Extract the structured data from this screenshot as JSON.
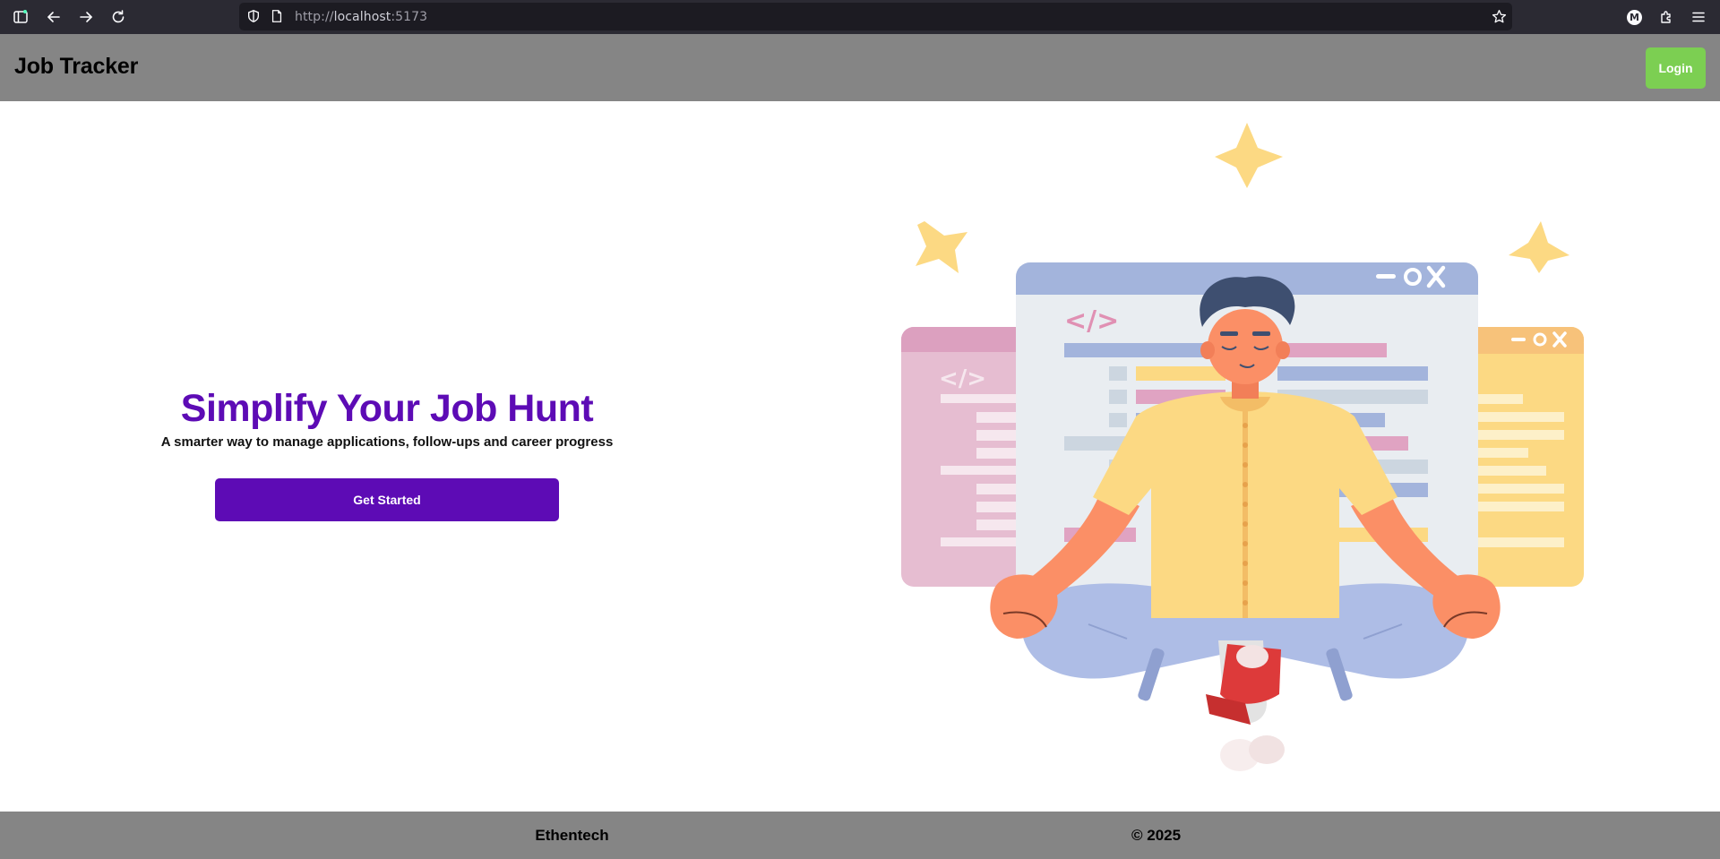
{
  "browser": {
    "url_scheme": "http://",
    "url_host": "localhost",
    "url_port": ":5173",
    "profile_initial": "M"
  },
  "header": {
    "title": "Job Tracker",
    "login_label": "Login"
  },
  "hero": {
    "title": "Simplify Your Job Hunt",
    "subtitle": "A smarter way to manage applications, follow-ups and career progress",
    "cta_label": "Get Started",
    "illustration": {
      "code_tag": "</>",
      "icons": [
        "star-icon",
        "window-minimize-icon",
        "window-maximize-icon",
        "window-close-icon"
      ]
    }
  },
  "footer": {
    "company": "Ethentech",
    "copyright": "© 2025"
  },
  "colors": {
    "header_bg": "#858585",
    "footer_bg": "#858585",
    "brand_purple": "#5d0bb5",
    "login_green": "#7ccf52",
    "star_yellow": "#fcd983",
    "window_blue": "#a3b4dc",
    "window_pink": "#e6bdd1",
    "window_yellow": "#fcd983"
  }
}
